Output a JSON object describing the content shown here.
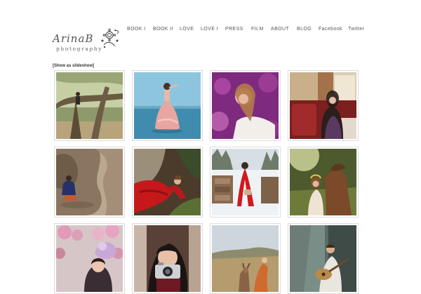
{
  "logo": {
    "script_text": "ArinaB",
    "subtitle": "photography",
    "icon": "flower-ornament-icon"
  },
  "nav": {
    "items": [
      {
        "label": "BOOK I"
      },
      {
        "label": "BOOK II"
      },
      {
        "label": "LOVE"
      },
      {
        "label": "LOVE I"
      },
      {
        "label": "PRESS"
      },
      {
        "label": "FILM"
      },
      {
        "label": "ABOUT"
      },
      {
        "label": "BLOG"
      },
      {
        "label": "Facebook"
      },
      {
        "label": "Twitter"
      }
    ]
  },
  "gallery": {
    "slideshow_link": "[Show as slideshow]",
    "photos": [
      {
        "subject": "woman-on-oak-tree"
      },
      {
        "subject": "woman-in-pink-gown-in-water"
      },
      {
        "subject": "woman-in-purple-flowers"
      },
      {
        "subject": "woman-in-red-diner-booth"
      },
      {
        "subject": "woman-in-rock-cave"
      },
      {
        "subject": "woman-in-red-dress-on-rock"
      },
      {
        "subject": "red-riding-hood-in-snow"
      },
      {
        "subject": "woman-with-horse"
      },
      {
        "subject": "woman-with-pink-blossoms"
      },
      {
        "subject": "woman-with-camera-in-car"
      },
      {
        "subject": "girl-with-deer-in-field"
      },
      {
        "subject": "man-playing-guitar"
      }
    ]
  }
}
